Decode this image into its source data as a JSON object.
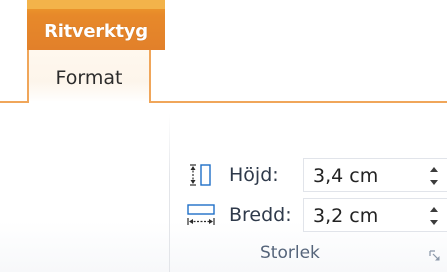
{
  "ribbon": {
    "context_tab_label": "Ritverktyg",
    "active_tab_label": "Format",
    "accent_color": "#e7892a",
    "tab_border_color": "#f0a65a"
  },
  "size_group": {
    "label": "Storlek",
    "height": {
      "label": "Höjd:",
      "value": "3,4 cm",
      "icon": "shape-height-icon"
    },
    "width": {
      "label": "Bredd:",
      "value": "3,2 cm",
      "icon": "shape-width-icon"
    },
    "launcher_icon": "dialog-launcher-icon"
  }
}
